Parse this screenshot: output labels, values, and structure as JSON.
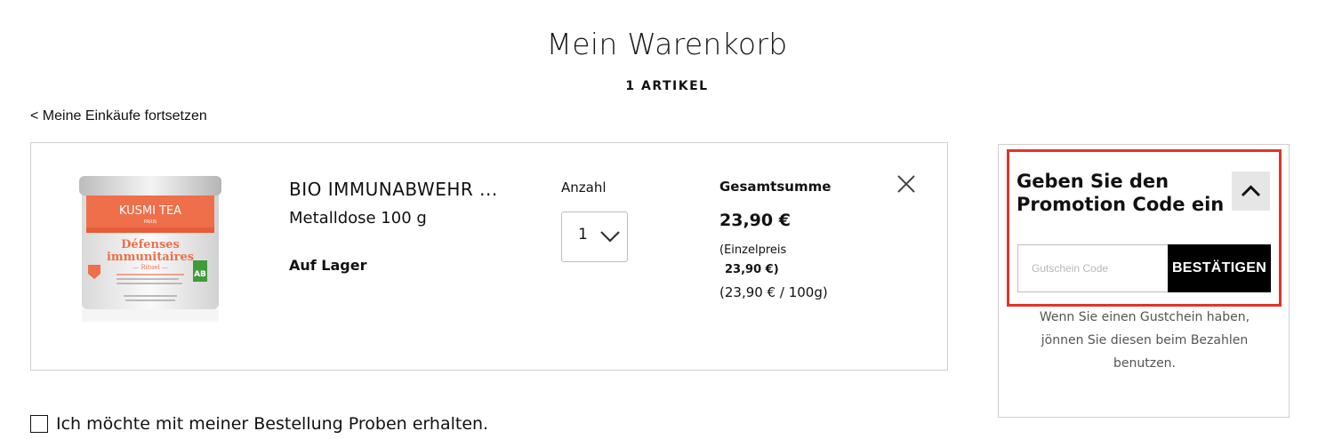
{
  "header": {
    "title": "Mein Warenkorb",
    "item_count": "1 ARTIKEL",
    "continue_link": "< Meine Einkäufe fortsetzen"
  },
  "cart": {
    "items": [
      {
        "name": "BIO IMMUNABWEHR ...",
        "variant": "Metalldose 100 g",
        "stock": "Auf Lager",
        "quantity_label": "Anzahl",
        "quantity": "1",
        "total_label": "Gesamtsumme",
        "total": "23,90 €",
        "unit_price_label": "(Einzelpreis",
        "unit_price": "23,90 €)",
        "base_price": "(23,90 € / 100g)",
        "image": {
          "brand": "KUSMI TEA",
          "brand_sub": "PARIS",
          "title_line1": "Défenses",
          "title_line2": "immunitaires",
          "subtitle": "— Rituel —",
          "organic_badge": "AB"
        }
      }
    ]
  },
  "promo": {
    "title": "Geben Sie den Promotion Code ein",
    "input_placeholder": "Gutschein Code",
    "submit_label": "BESTÄTIGEN",
    "hint": "Wenn Sie einen Gustchein haben, jönnen Sie diesen beim Bezahlen benutzen."
  },
  "samples": {
    "label": "Ich möchte mit meiner Bestellung Proben erhalten.",
    "checked": false
  },
  "colors": {
    "highlight": "#e2342a",
    "product_orange": "#ee6f4a",
    "button_bg": "#000000"
  }
}
